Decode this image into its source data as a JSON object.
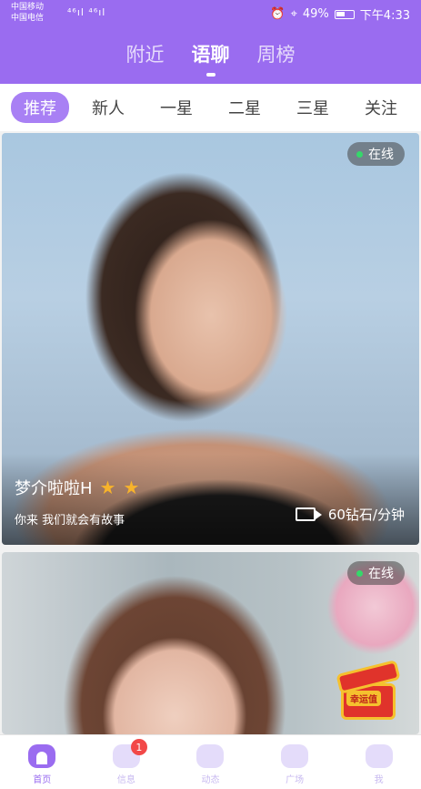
{
  "status_bar": {
    "carrier_1": "中国移动",
    "carrier_2": "中国电信",
    "signal_text": "⁴⁶ıl ⁴⁶ıl",
    "battery_pct": "49%",
    "time": "下午4:33"
  },
  "header": {
    "tabs": [
      {
        "label": "附近"
      },
      {
        "label": "语聊"
      },
      {
        "label": "周榜"
      }
    ],
    "active_tab": "语聊"
  },
  "categories": {
    "items": [
      {
        "label": "推荐"
      },
      {
        "label": "新人"
      },
      {
        "label": "一星"
      },
      {
        "label": "二星"
      },
      {
        "label": "三星"
      },
      {
        "label": "关注"
      }
    ],
    "active": "推荐"
  },
  "cards": [
    {
      "status": "在线",
      "name": "梦介啦啦H",
      "stars": 2,
      "bio": "你来 我们就会有故事",
      "price": "60钻石/分钟"
    },
    {
      "status": "在线",
      "promo_label": "幸运值"
    }
  ],
  "bottom_nav": {
    "items": [
      {
        "label": "首页",
        "icon": "home-icon"
      },
      {
        "label": "信息",
        "icon": "message-icon"
      },
      {
        "label": "动态",
        "icon": "moments-icon"
      },
      {
        "label": "广场",
        "icon": "plaza-icon"
      },
      {
        "label": "我",
        "icon": "profile-icon"
      }
    ],
    "message_badge": "1",
    "active": "首页"
  },
  "colors": {
    "accent": "#9a6cf0",
    "online_dot": "#35d86a",
    "star": "#f7b32b",
    "badge": "#f24848"
  }
}
